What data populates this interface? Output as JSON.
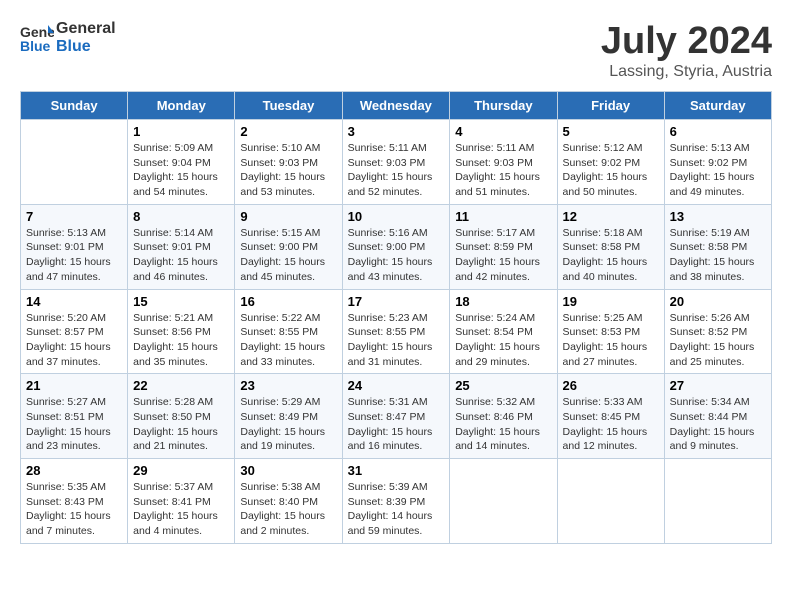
{
  "header": {
    "logo_general": "General",
    "logo_blue": "Blue",
    "title": "July 2024",
    "subtitle": "Lassing, Styria, Austria"
  },
  "days_of_week": [
    "Sunday",
    "Monday",
    "Tuesday",
    "Wednesday",
    "Thursday",
    "Friday",
    "Saturday"
  ],
  "weeks": [
    [
      {
        "day": "",
        "info": ""
      },
      {
        "day": "1",
        "info": "Sunrise: 5:09 AM\nSunset: 9:04 PM\nDaylight: 15 hours\nand 54 minutes."
      },
      {
        "day": "2",
        "info": "Sunrise: 5:10 AM\nSunset: 9:03 PM\nDaylight: 15 hours\nand 53 minutes."
      },
      {
        "day": "3",
        "info": "Sunrise: 5:11 AM\nSunset: 9:03 PM\nDaylight: 15 hours\nand 52 minutes."
      },
      {
        "day": "4",
        "info": "Sunrise: 5:11 AM\nSunset: 9:03 PM\nDaylight: 15 hours\nand 51 minutes."
      },
      {
        "day": "5",
        "info": "Sunrise: 5:12 AM\nSunset: 9:02 PM\nDaylight: 15 hours\nand 50 minutes."
      },
      {
        "day": "6",
        "info": "Sunrise: 5:13 AM\nSunset: 9:02 PM\nDaylight: 15 hours\nand 49 minutes."
      }
    ],
    [
      {
        "day": "7",
        "info": "Sunrise: 5:13 AM\nSunset: 9:01 PM\nDaylight: 15 hours\nand 47 minutes."
      },
      {
        "day": "8",
        "info": "Sunrise: 5:14 AM\nSunset: 9:01 PM\nDaylight: 15 hours\nand 46 minutes."
      },
      {
        "day": "9",
        "info": "Sunrise: 5:15 AM\nSunset: 9:00 PM\nDaylight: 15 hours\nand 45 minutes."
      },
      {
        "day": "10",
        "info": "Sunrise: 5:16 AM\nSunset: 9:00 PM\nDaylight: 15 hours\nand 43 minutes."
      },
      {
        "day": "11",
        "info": "Sunrise: 5:17 AM\nSunset: 8:59 PM\nDaylight: 15 hours\nand 42 minutes."
      },
      {
        "day": "12",
        "info": "Sunrise: 5:18 AM\nSunset: 8:58 PM\nDaylight: 15 hours\nand 40 minutes."
      },
      {
        "day": "13",
        "info": "Sunrise: 5:19 AM\nSunset: 8:58 PM\nDaylight: 15 hours\nand 38 minutes."
      }
    ],
    [
      {
        "day": "14",
        "info": "Sunrise: 5:20 AM\nSunset: 8:57 PM\nDaylight: 15 hours\nand 37 minutes."
      },
      {
        "day": "15",
        "info": "Sunrise: 5:21 AM\nSunset: 8:56 PM\nDaylight: 15 hours\nand 35 minutes."
      },
      {
        "day": "16",
        "info": "Sunrise: 5:22 AM\nSunset: 8:55 PM\nDaylight: 15 hours\nand 33 minutes."
      },
      {
        "day": "17",
        "info": "Sunrise: 5:23 AM\nSunset: 8:55 PM\nDaylight: 15 hours\nand 31 minutes."
      },
      {
        "day": "18",
        "info": "Sunrise: 5:24 AM\nSunset: 8:54 PM\nDaylight: 15 hours\nand 29 minutes."
      },
      {
        "day": "19",
        "info": "Sunrise: 5:25 AM\nSunset: 8:53 PM\nDaylight: 15 hours\nand 27 minutes."
      },
      {
        "day": "20",
        "info": "Sunrise: 5:26 AM\nSunset: 8:52 PM\nDaylight: 15 hours\nand 25 minutes."
      }
    ],
    [
      {
        "day": "21",
        "info": "Sunrise: 5:27 AM\nSunset: 8:51 PM\nDaylight: 15 hours\nand 23 minutes."
      },
      {
        "day": "22",
        "info": "Sunrise: 5:28 AM\nSunset: 8:50 PM\nDaylight: 15 hours\nand 21 minutes."
      },
      {
        "day": "23",
        "info": "Sunrise: 5:29 AM\nSunset: 8:49 PM\nDaylight: 15 hours\nand 19 minutes."
      },
      {
        "day": "24",
        "info": "Sunrise: 5:31 AM\nSunset: 8:47 PM\nDaylight: 15 hours\nand 16 minutes."
      },
      {
        "day": "25",
        "info": "Sunrise: 5:32 AM\nSunset: 8:46 PM\nDaylight: 15 hours\nand 14 minutes."
      },
      {
        "day": "26",
        "info": "Sunrise: 5:33 AM\nSunset: 8:45 PM\nDaylight: 15 hours\nand 12 minutes."
      },
      {
        "day": "27",
        "info": "Sunrise: 5:34 AM\nSunset: 8:44 PM\nDaylight: 15 hours\nand 9 minutes."
      }
    ],
    [
      {
        "day": "28",
        "info": "Sunrise: 5:35 AM\nSunset: 8:43 PM\nDaylight: 15 hours\nand 7 minutes."
      },
      {
        "day": "29",
        "info": "Sunrise: 5:37 AM\nSunset: 8:41 PM\nDaylight: 15 hours\nand 4 minutes."
      },
      {
        "day": "30",
        "info": "Sunrise: 5:38 AM\nSunset: 8:40 PM\nDaylight: 15 hours\nand 2 minutes."
      },
      {
        "day": "31",
        "info": "Sunrise: 5:39 AM\nSunset: 8:39 PM\nDaylight: 14 hours\nand 59 minutes."
      },
      {
        "day": "",
        "info": ""
      },
      {
        "day": "",
        "info": ""
      },
      {
        "day": "",
        "info": ""
      }
    ]
  ]
}
